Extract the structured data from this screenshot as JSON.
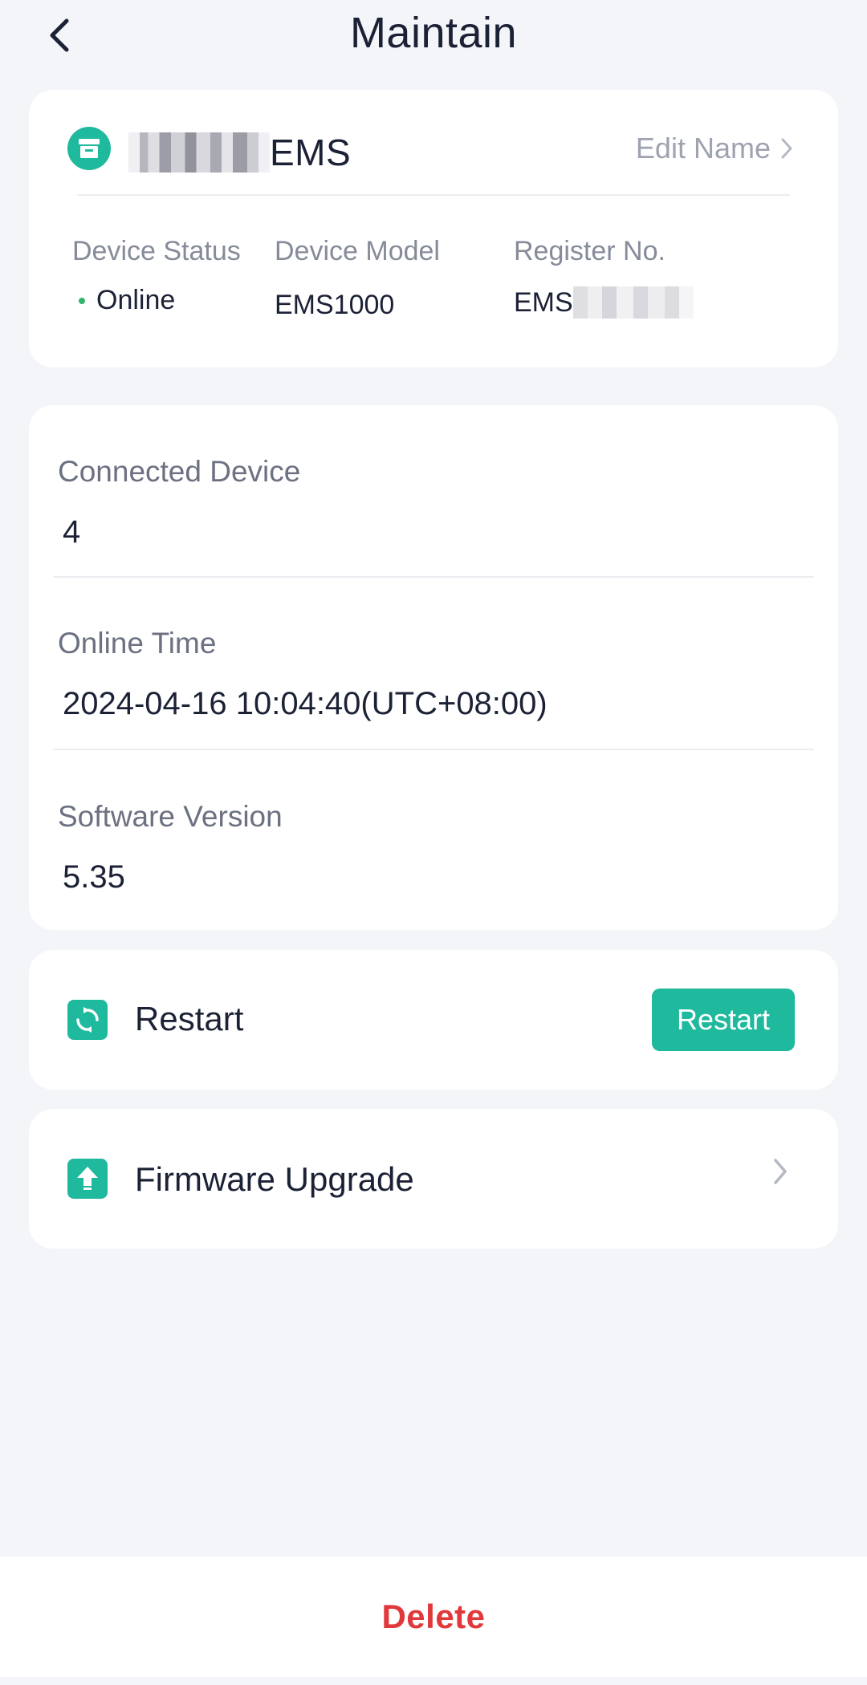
{
  "header": {
    "title": "Maintain",
    "back_icon": "chevron-left-icon"
  },
  "device": {
    "icon": "device-box-icon",
    "name_suffix": "EMS",
    "edit_label": "Edit Name",
    "status_label": "Device Status",
    "status_value": "Online",
    "model_label": "Device Model",
    "model_value": "EMS1000",
    "register_label": "Register No.",
    "register_value_prefix": "EMS"
  },
  "details": {
    "connected_label": "Connected Device",
    "connected_value": "4",
    "online_time_label": "Online Time",
    "online_time_value": "2024-04-16 10:04:40(UTC+08:00)",
    "software_label": "Software Version",
    "software_value": "5.35"
  },
  "restart": {
    "label": "Restart",
    "button_label": "Restart",
    "icon": "restart-icon"
  },
  "firmware": {
    "label": "Firmware Upgrade",
    "icon": "upload-icon"
  },
  "footer": {
    "delete_label": "Delete"
  },
  "colors": {
    "accent": "#1fb99e",
    "danger": "#e0383b",
    "online": "#33b36b",
    "background": "#f4f5f8"
  }
}
